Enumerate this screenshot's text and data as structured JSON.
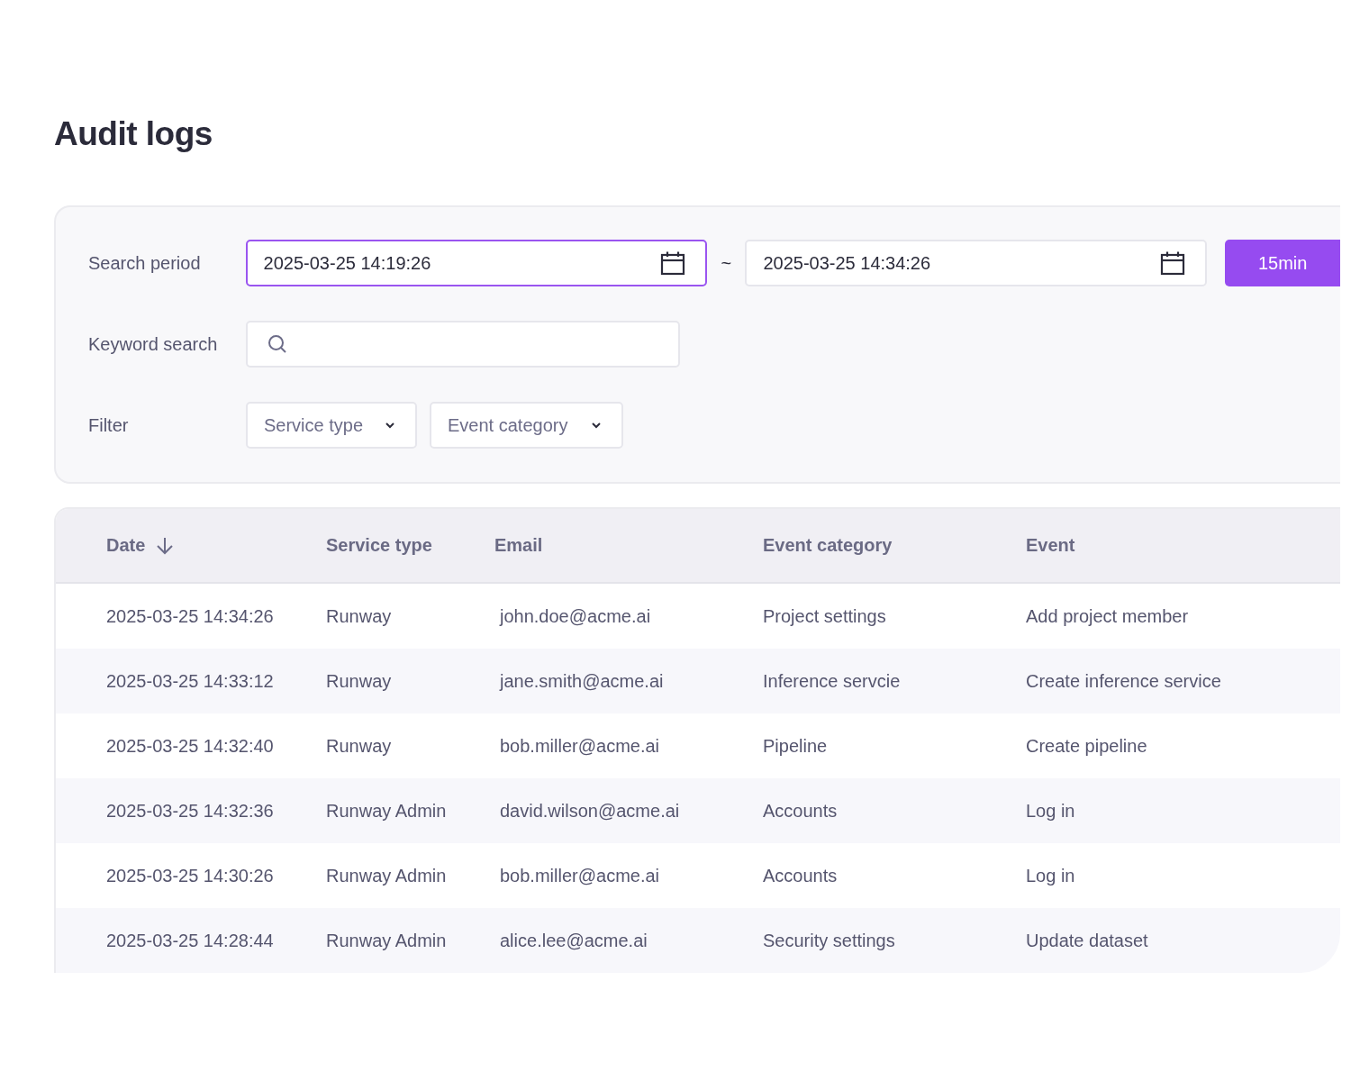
{
  "title": "Audit logs",
  "search": {
    "period_label": "Search period",
    "start": {
      "value": "2025-03-25 14:19:26",
      "focused": true
    },
    "separator": "~",
    "end": {
      "value": "2025-03-25 14:34:26",
      "focused": false
    },
    "preset_button": "15min",
    "keyword_label": "Keyword search",
    "filter_label": "Filter",
    "filters": [
      {
        "label": "Service type"
      },
      {
        "label": "Event category"
      }
    ]
  },
  "table": {
    "columns": [
      {
        "label": "Date",
        "sorted": true
      },
      {
        "label": "Service type",
        "sorted": false
      },
      {
        "label": "Email",
        "sorted": false
      },
      {
        "label": "Event category",
        "sorted": false
      },
      {
        "label": "Event",
        "sorted": false
      }
    ],
    "rows": [
      [
        "2025-03-25 14:34:26",
        "Runway",
        "john.doe@acme.ai",
        "Project settings",
        "Add project member"
      ],
      [
        "2025-03-25 14:33:12",
        "Runway",
        "jane.smith@acme.ai",
        "Inference servcie",
        "Create inference service"
      ],
      [
        "2025-03-25 14:32:40",
        "Runway",
        "bob.miller@acme.ai",
        "Pipeline",
        "Create pipeline"
      ],
      [
        "2025-03-25 14:32:36",
        "Runway Admin",
        "david.wilson@acme.ai",
        "Accounts",
        "Log in"
      ],
      [
        "2025-03-25 14:30:26",
        "Runway Admin",
        "bob.miller@acme.ai",
        "Accounts",
        "Log in"
      ],
      [
        "2025-03-25 14:28:44",
        "Runway Admin",
        "alice.lee@acme.ai",
        "Security settings",
        "Update dataset"
      ]
    ]
  }
}
